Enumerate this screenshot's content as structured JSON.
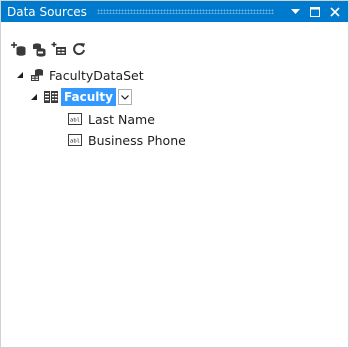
{
  "window": {
    "title": "Data Sources"
  },
  "tree": {
    "dataset": {
      "label": "FacultyDataSet"
    },
    "table": {
      "label": "Faculty"
    },
    "columns": [
      {
        "label": "Last Name"
      },
      {
        "label": "Business Phone"
      }
    ]
  },
  "icons": {
    "toolbar": [
      "add-data-source-icon",
      "edit-dataset-icon",
      "add-query-icon",
      "refresh-icon"
    ],
    "dataset": "dataset-icon",
    "table": "datatable-icon",
    "column": "textbox-field-icon"
  },
  "colors": {
    "titlebar": "#007acc",
    "selection": "#3399ff"
  }
}
